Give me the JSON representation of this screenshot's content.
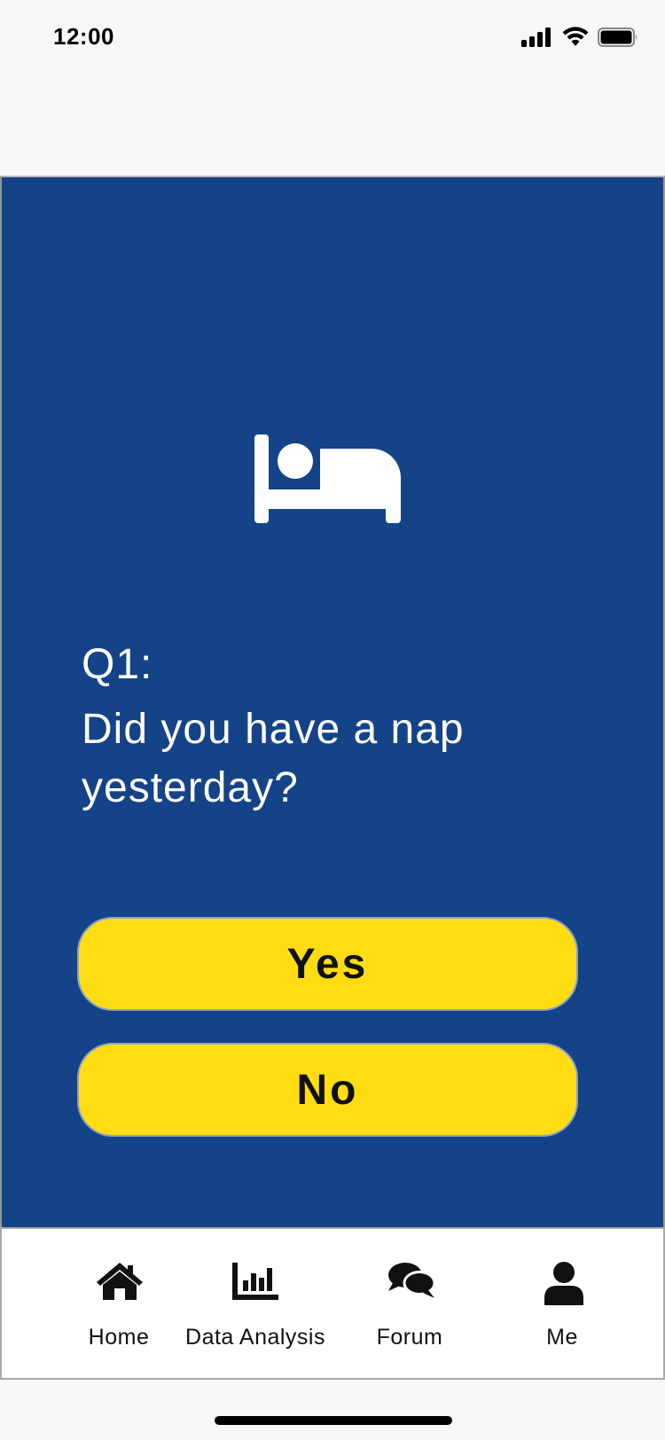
{
  "status_bar": {
    "time": "12:00",
    "icons": [
      "signal-icon",
      "wifi-icon",
      "battery-icon"
    ]
  },
  "question": {
    "icon": "bed-icon",
    "number": "Q1:",
    "text": "Did you have a nap yesterday?"
  },
  "answers": {
    "yes": "Yes",
    "no": "No"
  },
  "tab_bar": {
    "items": [
      {
        "label": "Home",
        "icon": "home-icon"
      },
      {
        "label": "Data Analysis",
        "icon": "bar-chart-icon"
      },
      {
        "label": "Forum",
        "icon": "chat-bubbles-icon"
      },
      {
        "label": "Me",
        "icon": "user-icon"
      }
    ]
  },
  "colors": {
    "panel_background": "#144387",
    "button_yellow": "#ffdd12",
    "page_background": "#f7f7f7"
  }
}
